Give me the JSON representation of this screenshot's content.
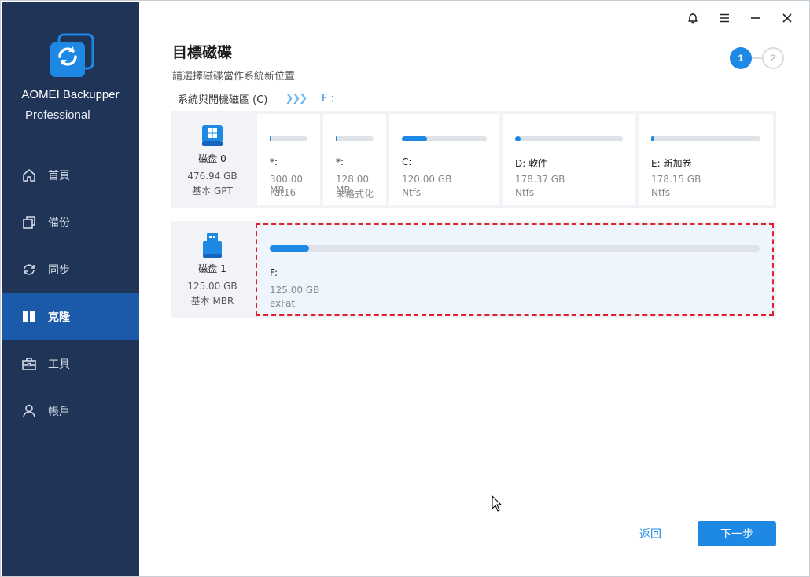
{
  "app": {
    "name": "AOMEI Backupper",
    "edition": "Professional"
  },
  "titlebar": {
    "icons": [
      "bell-icon",
      "menu-icon",
      "minimize-icon",
      "close-icon"
    ]
  },
  "sidebar": {
    "items": [
      {
        "label": "首頁",
        "icon": "home-icon",
        "active": false
      },
      {
        "label": "備份",
        "icon": "backup-icon",
        "active": false
      },
      {
        "label": "同步",
        "icon": "sync-icon",
        "active": false
      },
      {
        "label": "克隆",
        "icon": "clone-icon",
        "active": true
      },
      {
        "label": "工具",
        "icon": "toolbox-icon",
        "active": false
      },
      {
        "label": "帳戶",
        "icon": "user-icon",
        "active": false
      }
    ]
  },
  "header": {
    "title": "目標磁碟",
    "subtitle": "請選擇磁碟當作系統新位置",
    "steps": [
      "1",
      "2"
    ],
    "current_step": 1
  },
  "crumb": {
    "source": "系統與開機磁區 (C)",
    "arrows": "❯❯❯",
    "destination": "F :"
  },
  "disks": [
    {
      "name": "磁盘 0",
      "size": "476.94 GB",
      "type": "基本 GPT",
      "partitions": [
        {
          "name": "*:",
          "size": "300.00 MB",
          "fs": "Fat16",
          "used_fraction": 0.05
        },
        {
          "name": "*:",
          "size": "128.00 MB",
          "fs": "未格式化",
          "used_fraction": 0.05
        },
        {
          "name": "C:",
          "size": "120.00 GB",
          "fs": "Ntfs",
          "used_fraction": 0.3
        },
        {
          "name": "D: 軟件",
          "size": "178.37 GB",
          "fs": "Ntfs",
          "used_fraction": 0.05
        },
        {
          "name": "E: 新加卷",
          "size": "178.15 GB",
          "fs": "Ntfs",
          "used_fraction": 0.03
        }
      ]
    },
    {
      "name": "磁盘 1",
      "size": "125.00 GB",
      "type": "基本 MBR",
      "partitions": [
        {
          "name": "F:",
          "size": "125.00 GB",
          "fs": "exFat",
          "used_fraction": 0.08,
          "selected": true
        }
      ]
    }
  ],
  "footer": {
    "back_label": "返回",
    "next_label": "下一步"
  },
  "colors": {
    "sidebar_bg": "#1f3457",
    "sidebar_active": "#1a5aa8",
    "accent": "#1e88e5",
    "selection_border": "#e0212b"
  }
}
